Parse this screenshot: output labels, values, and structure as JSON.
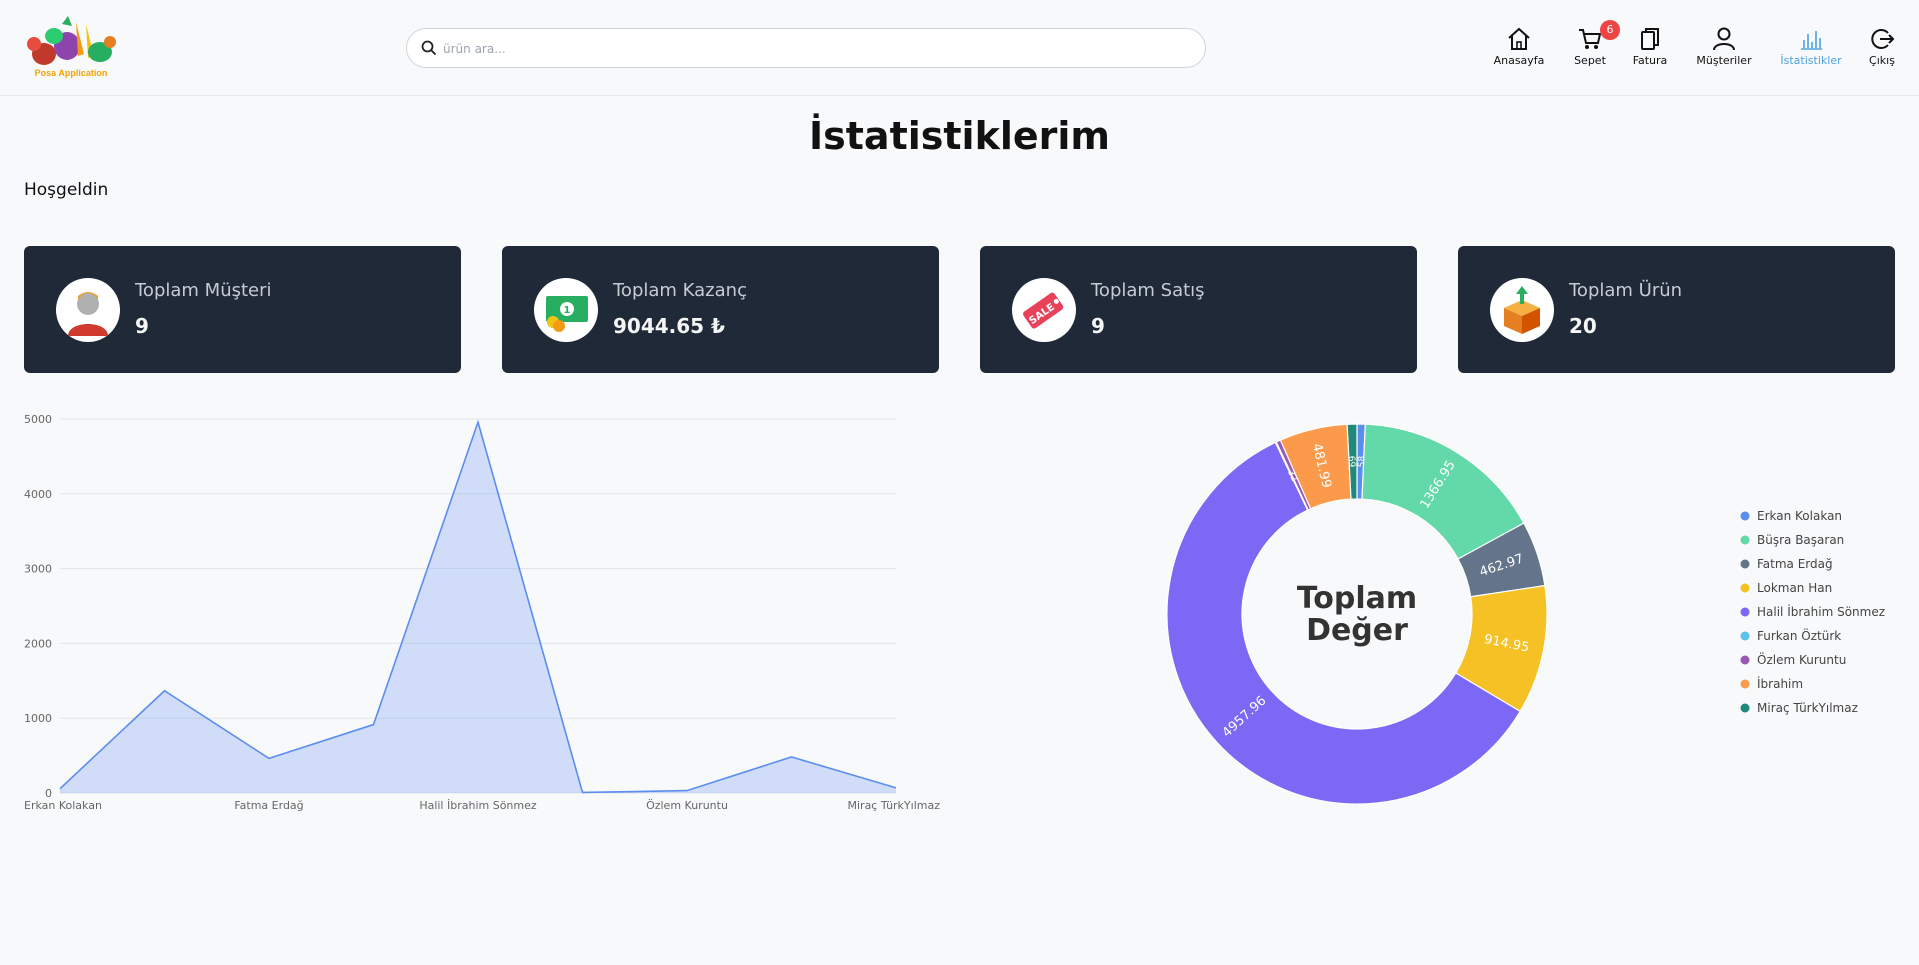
{
  "app": {
    "logo_text": "Posa Application"
  },
  "search": {
    "placeholder": "ürün ara..."
  },
  "nav": {
    "home": "Anasayfa",
    "cart": "Sepet",
    "cart_badge": "6",
    "invoice": "Fatura",
    "customers": "Müşteriler",
    "stats": "İstatistikler",
    "logout": "Çıkış"
  },
  "page": {
    "title": "İstatistiklerim",
    "welcome": "Hoşgeldin"
  },
  "cards": [
    {
      "title": "Toplam Müşteri",
      "value": "9"
    },
    {
      "title": "Toplam Kazanç",
      "value": "9044.65 ₺"
    },
    {
      "title": "Toplam Satış",
      "value": "9"
    },
    {
      "title": "Toplam Ürün",
      "value": "20"
    }
  ],
  "colors": {
    "accent": "#4aa3df",
    "card_bg": "#1f2937",
    "badge": "#ef4444"
  },
  "chart_data": [
    {
      "type": "area",
      "x": [
        "Erkan Kolakan",
        "Büşra Başaran",
        "Fatma Erdağ",
        "Lokman Han",
        "Halil İbrahim Sönmez",
        "Furkan Öztürk",
        "Özlem Kuruntu",
        "İbrahim",
        "Miraç TürkYılmaz"
      ],
      "x_tick_labels": [
        "Erkan Kolakan",
        "Fatma Erdağ",
        "Halil İbrahim Sönmez",
        "Özlem Kuruntu",
        "Miraç TürkYılmaz"
      ],
      "values": [
        58,
        1366.95,
        462.97,
        914.95,
        4957.96,
        7,
        32,
        481.99,
        69
      ],
      "ylim": [
        0,
        5000
      ],
      "yticks": [
        0,
        1000,
        2000,
        3000,
        4000,
        5000
      ],
      "grid": true,
      "color": "#5b8def"
    },
    {
      "type": "pie",
      "center_label": "Toplam Değer",
      "labels": [
        "Erkan Kolakan",
        "Büşra Başaran",
        "Fatma Erdağ",
        "Lokman Han",
        "Halil İbrahim Sönmez",
        "Furkan Öztürk",
        "Özlem Kuruntu",
        "İbrahim",
        "Miraç TürkYılmaz"
      ],
      "values": [
        58,
        1366.95,
        462.97,
        914.95,
        4957.96,
        7,
        32,
        481.99,
        69
      ],
      "slice_labels": [
        "58",
        "1366.95",
        "462.97",
        "914.95",
        "4957.96",
        "",
        "32",
        "481.99",
        "69"
      ],
      "colors": [
        "#5b8def",
        "#63d8a8",
        "#64748b",
        "#f5c125",
        "#7b68f5",
        "#5bc0eb",
        "#9b59b6",
        "#fb9a4b",
        "#1f8a7a"
      ],
      "legend": "right"
    }
  ]
}
